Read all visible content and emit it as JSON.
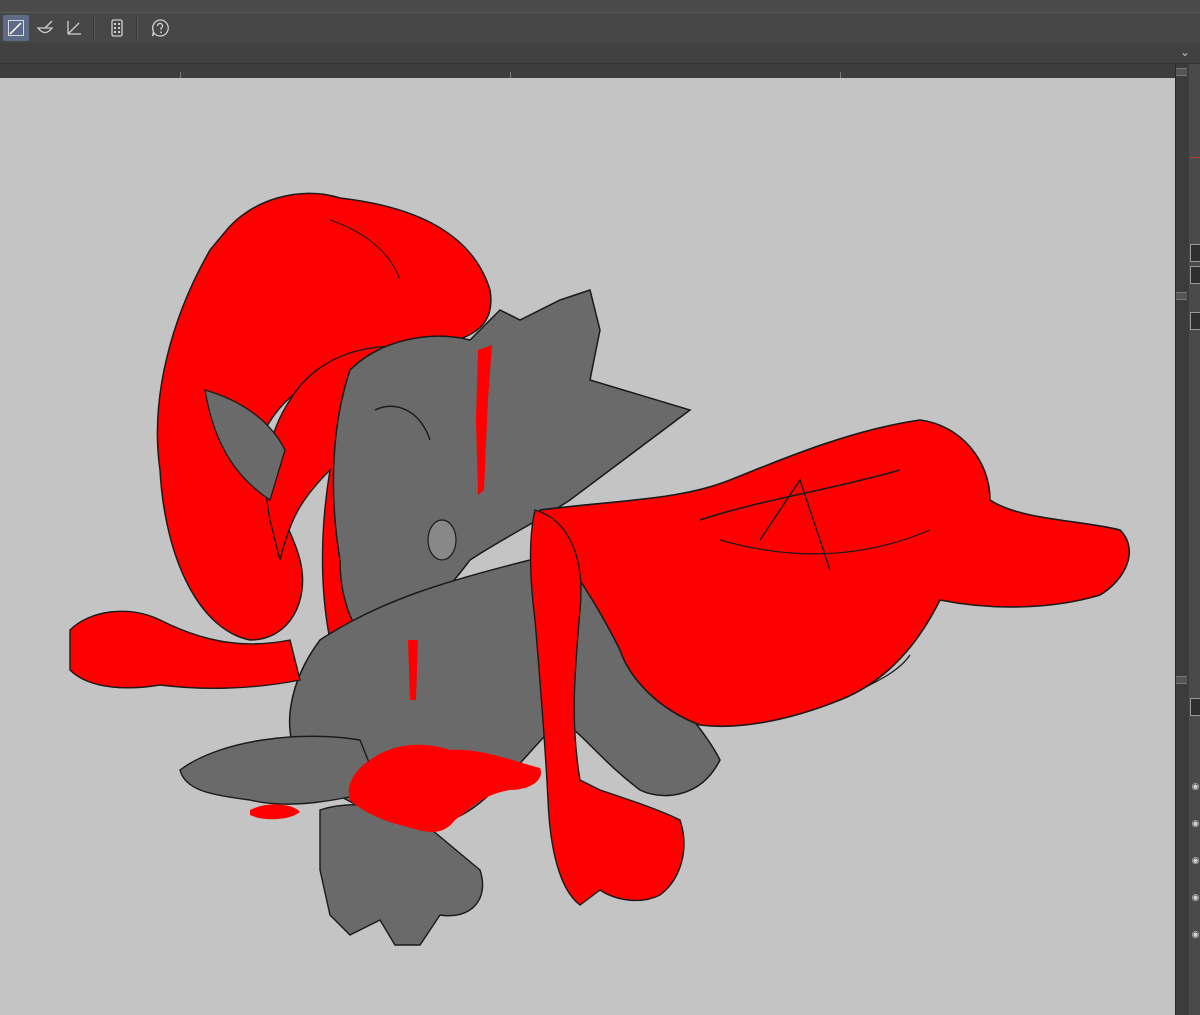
{
  "toolbar": {
    "tools": [
      {
        "icon": "select-arrow-icon",
        "active": true
      },
      {
        "icon": "bowl-brush-icon",
        "active": false
      },
      {
        "icon": "angle-ruler-icon",
        "active": false
      },
      {
        "icon": "mobile-device-icon",
        "active": false
      },
      {
        "icon": "help-bubble-icon",
        "active": false
      }
    ],
    "active_color": "#5d6b88"
  },
  "subbar": {
    "chevron_icon": "chevron-down-icon"
  },
  "canvas": {
    "background_color": "#c4c4c4",
    "fill_red": "#ff0000",
    "fill_gray": "#6a6a6a",
    "line_color": "#1a1a1a"
  },
  "right_panel": {
    "eye_icons": [
      "eye-icon",
      "eye-icon",
      "eye-icon",
      "eye-icon",
      "eye-icon"
    ]
  }
}
